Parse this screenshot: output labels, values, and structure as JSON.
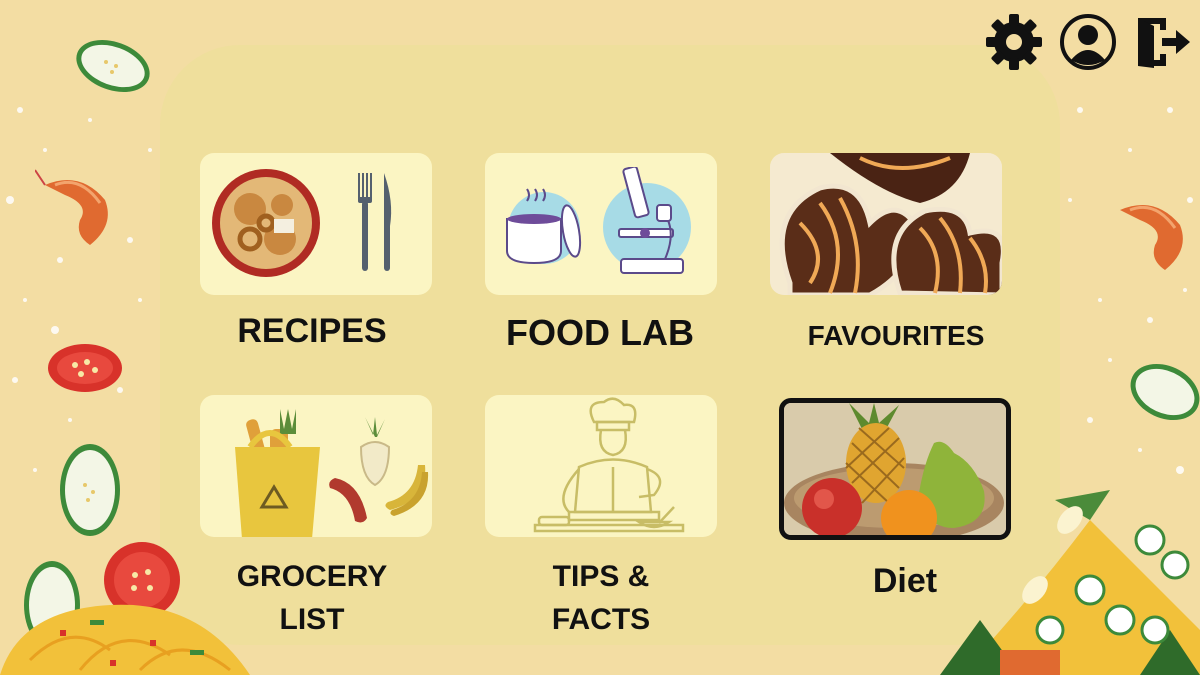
{
  "header": {
    "icons": [
      "gear-icon",
      "user-profile-icon",
      "logout-icon"
    ]
  },
  "menu": {
    "recipes": "RECIPES",
    "food_lab": "FOOD LAB",
    "favourites": "FAVOURITES",
    "grocery_line1": "GROCERY",
    "grocery_line2": "LIST",
    "tips_line1": "TIPS &",
    "tips_line2": "FACTS",
    "diet": "Diet"
  },
  "colors": {
    "background": "#f3dda3",
    "panel": "#efdf9c",
    "card": "#fbf5c3",
    "text": "#111111"
  }
}
